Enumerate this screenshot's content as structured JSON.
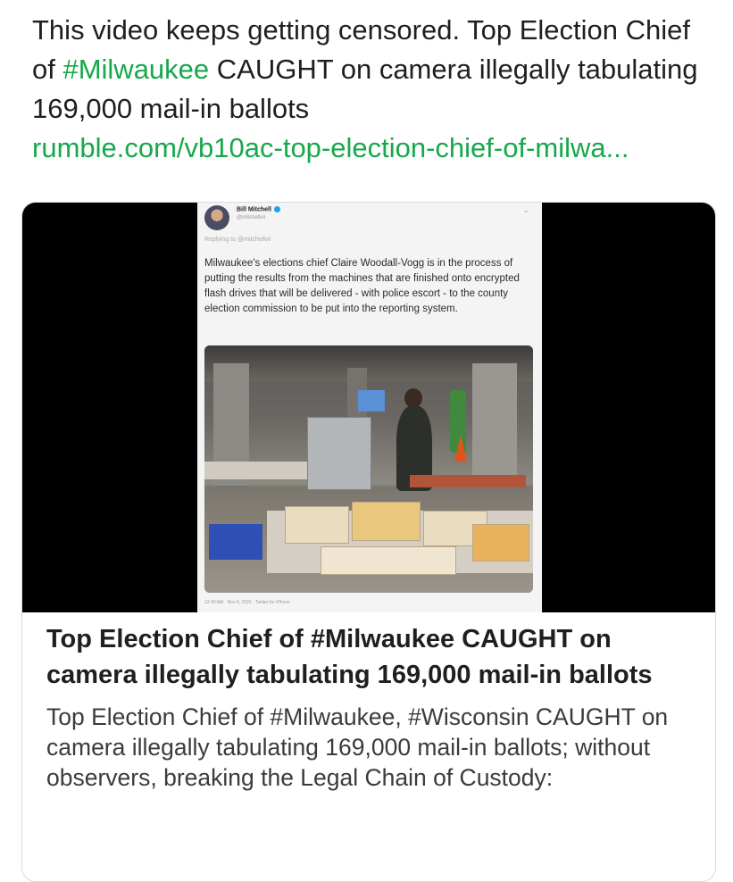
{
  "tweet": {
    "text_prefix": "This video keeps getting censored. Top Election Chief of ",
    "hashtag": "#Milwaukee",
    "text_suffix": " CAUGHT on camera illegally tabulating 169,000 mail-in ballots",
    "link": "rumble.com/vb10ac-top-election-chief-of-milwa..."
  },
  "card": {
    "title": "Top Election Chief of #Milwaukee CAUGHT on camera illegally tabulating 169,000 mail-in ballots",
    "description": "Top Election Chief of #Milwaukee, #Wisconsin CAUGHT on camera illegally tabulating 169,000 mail-in ballots; without observers, breaking the Legal Chain of Custody:",
    "screenshot": {
      "name": "Bill Mitchell",
      "handle": "@mitchellvii",
      "replying_to": "Replying to @mitchellvii",
      "body": "Milwaukee's elections chief Claire Woodall-Vogg is in the process of putting the results from the machines that are finished onto encrypted flash drives that will be delivered - with police escort - to the county election commission to be put into the reporting system.",
      "footer": "12:40 AM · Nov 4, 2020 · Twitter for iPhone"
    }
  },
  "colors": {
    "hashtag": "#17a84b",
    "link": "#17a84b",
    "card_border": "#d7dbdf",
    "media_background": "#000000"
  }
}
